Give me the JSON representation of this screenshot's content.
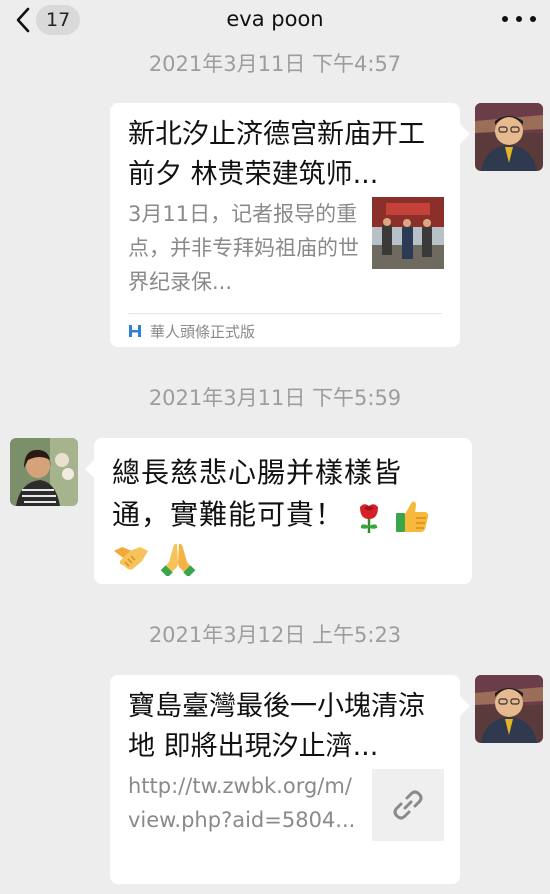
{
  "header": {
    "back_count": "17",
    "title": "eva poon"
  },
  "messages": [
    {
      "timestamp": "2021年3月11日 下午4:57",
      "card_title": "新北汐止济德宫新庙开工前夕 林贵荣建筑师...",
      "card_desc": "3月11日，记者报导的重点，并非专拜妈祖庙的世界纪录保...",
      "source": "華人頭條正式版"
    },
    {
      "timestamp": "2021年3月11日 下午5:59",
      "text": "總長慈悲心腸并樣樣皆通，實難能可貴！",
      "emojis": [
        "rose-icon",
        "thumbs-up-icon",
        "handshake-icon",
        "folded-hands-icon"
      ]
    },
    {
      "timestamp": "2021年3月12日 上午5:23",
      "card_title": "寶島臺灣最後一小塊清涼地 即將出現汐止濟...",
      "card_desc": "http://tw.zwbk.org/m/view.php?aid=5804...",
      "icon": "link-icon"
    }
  ],
  "colors": {
    "background": "#ededed",
    "bubble": "#ffffff",
    "timestamp": "#9d9d9d",
    "description": "#8a8a8a"
  }
}
